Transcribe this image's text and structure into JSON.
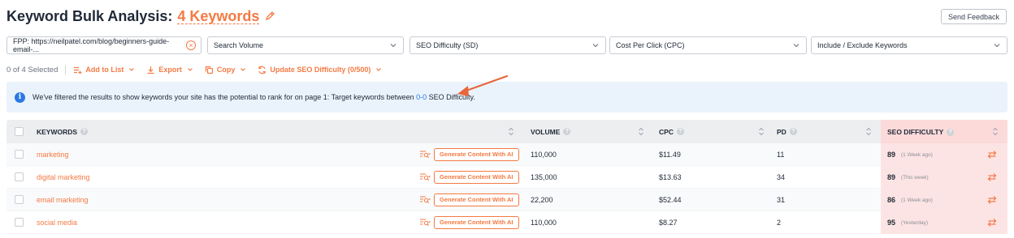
{
  "header": {
    "title": "Keyword Bulk Analysis:",
    "count_label": "4 Keywords",
    "feedback_label": "Send Feedback"
  },
  "filters": {
    "fpp_value": "FPP: https://neilpatel.com/blog/beginners-guide-email-...",
    "volume": "Search Volume",
    "sd": "SEO Difficulty (SD)",
    "cpc": "Cost Per Click (CPC)",
    "include": "Include / Exclude Keywords"
  },
  "actions": {
    "selected": "0 of 4 Selected",
    "add_to_list": "Add to List",
    "export": "Export",
    "copy": "Copy",
    "update_sd": "Update SEO Difficulty (0/500)"
  },
  "notice": {
    "text_before": "We've filtered the results to show keywords your site has the potential to rank for on page 1: Target keywords between ",
    "range": "0-0",
    "text_after": " SEO Difficulty."
  },
  "table": {
    "columns": {
      "keywords": "KEYWORDS",
      "volume": "VOLUME",
      "cpc": "CPC",
      "pd": "PD",
      "sd": "SEO DIFFICULTY"
    },
    "generate_label": "Generate Content With AI",
    "rows": [
      {
        "keyword": "marketing",
        "volume": "110,000",
        "cpc": "$11.49",
        "pd": "11",
        "sd": "89",
        "sd_when": "(1 Week ago)"
      },
      {
        "keyword": "digital marketing",
        "volume": "135,000",
        "cpc": "$13.63",
        "pd": "34",
        "sd": "89",
        "sd_when": "(This week)"
      },
      {
        "keyword": "email marketing",
        "volume": "22,200",
        "cpc": "$52.44",
        "pd": "31",
        "sd": "86",
        "sd_when": "(1 Week ago)"
      },
      {
        "keyword": "social media",
        "volume": "110,000",
        "cpc": "$8.27",
        "pd": "2",
        "sd": "95",
        "sd_when": "(Yesterday)"
      }
    ]
  },
  "colors": {
    "accent": "#f47a44",
    "info_blue": "#2b78e4",
    "notice_bg": "#eaf3fc",
    "sd_bg": "#fde4e4"
  }
}
